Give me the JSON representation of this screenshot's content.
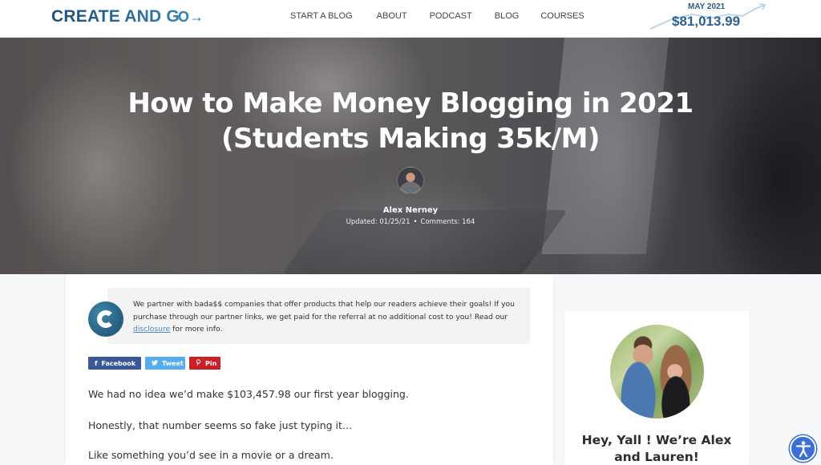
{
  "header": {
    "logo_text": "CREATE AND G",
    "logo_arrow": "O→",
    "nav": [
      {
        "label": "START A BLOG"
      },
      {
        "label": "ABOUT"
      },
      {
        "label": "PODCAST"
      },
      {
        "label": "BLOG"
      },
      {
        "label": "COURSES"
      }
    ],
    "income": {
      "month": "MAY 2021",
      "amount": "$81,013.99",
      "trend_icon": "trend-arrow-up-icon"
    }
  },
  "hero": {
    "title_line1": "How to Make Money Blogging in 2021",
    "title_line2": "(Students Making 35k/M)",
    "author": "Alex Nerney",
    "updated": "Updated: 01/25/21",
    "separator": "•",
    "comments": "Comments: 164"
  },
  "article": {
    "disclosure": {
      "text_before": "We partner with bada$$ companies that offer products that help our readers achieve their goals! If you purchase through our partner links, we get paid for the referral at no additional cost to you! Read our ",
      "link": "disclosure",
      "text_after": " for more info."
    },
    "share": [
      {
        "icon": "f",
        "label": "Facebook",
        "color": "#3b5998"
      },
      {
        "icon": "🐦",
        "label": "Tweet",
        "color": "#55acee"
      },
      {
        "icon": "℗",
        "label": "Pin",
        "color": "#cb2027"
      }
    ],
    "paragraphs": [
      "We had no idea we’d make $103,457.98 our first year blogging.",
      "Honestly, that number seems so fake just typing it…",
      "Like something you’d see in a movie or a dream."
    ]
  },
  "sidebar": {
    "heading_line1": "Hey, Yall ! We’re Alex",
    "heading_line2": "and Lauren!"
  },
  "accessibility": {
    "icon": "accessibility-icon"
  },
  "colors": {
    "brand_blue": "#23527c",
    "facebook": "#3b5998",
    "twitter": "#55acee",
    "pinterest": "#cb2027",
    "a11y_blue": "#3a6fd8"
  }
}
